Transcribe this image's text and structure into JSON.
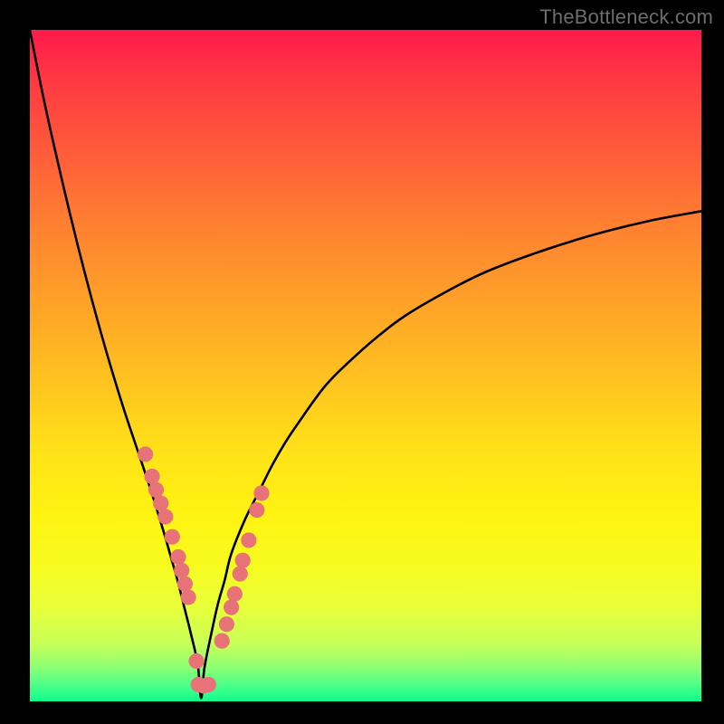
{
  "watermark": "TheBottleneck.com",
  "colors": {
    "background": "#000000",
    "dot": "#e77379",
    "curve": "#000000",
    "gradient_top": "#ff1a4b",
    "gradient_bottom": "#11ff8e"
  },
  "chart_data": {
    "type": "line",
    "title": "",
    "xlabel": "",
    "ylabel": "",
    "xlim": [
      0,
      100
    ],
    "ylim": [
      0,
      100
    ],
    "minimum_x": 25.5,
    "series": [
      {
        "name": "bottleneck-curve",
        "x": [
          0,
          2,
          4,
          6,
          8,
          10,
          12,
          14,
          16,
          18,
          20,
          21,
          22,
          23,
          24,
          25,
          25.5,
          26,
          27,
          28,
          29,
          30,
          32,
          34,
          36,
          38,
          40,
          44,
          48,
          52,
          56,
          62,
          68,
          76,
          84,
          92,
          100
        ],
        "values": [
          100,
          90,
          81,
          72.5,
          64.5,
          57,
          50,
          43.5,
          37.5,
          31.5,
          25,
          21.5,
          18,
          14,
          10,
          5.5,
          0.5,
          5,
          10,
          14.5,
          18,
          22,
          27,
          31,
          35,
          38.5,
          41.5,
          47,
          51,
          54.5,
          57.5,
          61,
          64,
          67,
          69.5,
          71.5,
          73
        ]
      }
    ],
    "markers": {
      "name": "highlighted-points",
      "x": [
        17.2,
        18.2,
        18.8,
        19.5,
        20.2,
        21.2,
        22.1,
        22.6,
        23.1,
        23.6,
        24.8,
        25.1,
        25.9,
        26.6,
        28.6,
        29.3,
        30.0,
        30.5,
        31.3,
        31.7,
        32.6,
        33.8,
        34.5
      ],
      "values": [
        36.8,
        33.5,
        31.5,
        29.5,
        27.5,
        24.5,
        21.5,
        19.5,
        17.5,
        15.5,
        6.0,
        2.5,
        2.3,
        2.5,
        9.0,
        11.5,
        14.0,
        16.0,
        19.0,
        21.0,
        24.0,
        28.5,
        31.0
      ]
    },
    "annotations": []
  }
}
